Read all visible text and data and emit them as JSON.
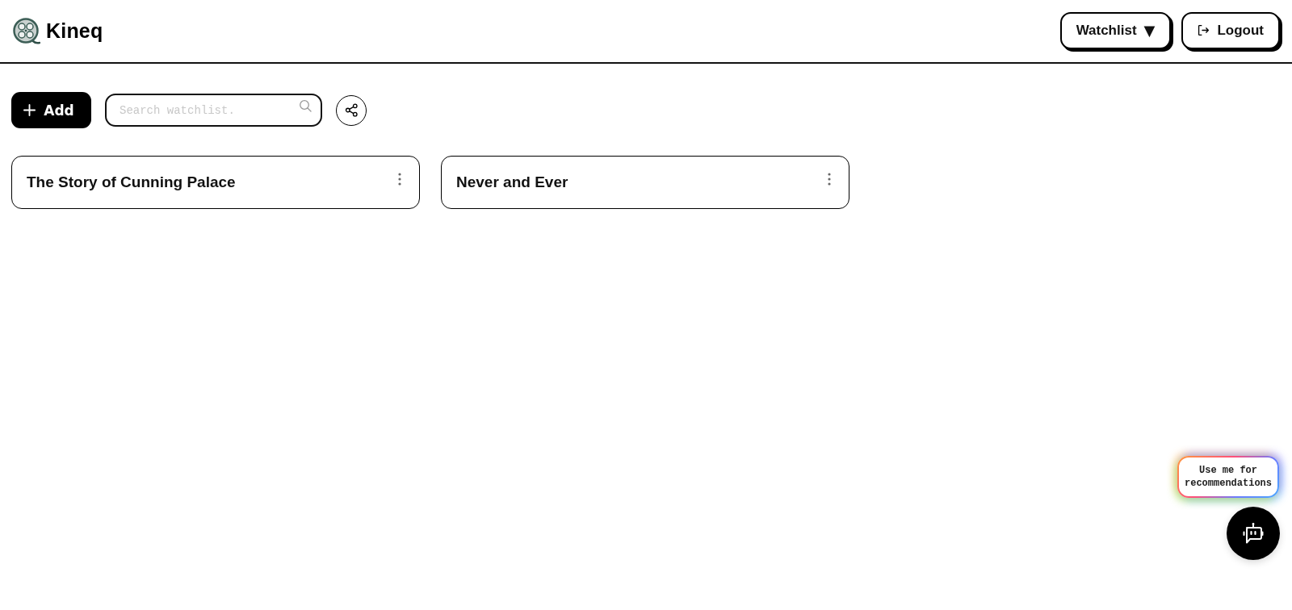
{
  "header": {
    "brand": "Kineq",
    "buttons": [
      {
        "kind": "dropdown",
        "label": "Watchlist",
        "caret": "▼"
      },
      {
        "kind": "logout",
        "label": "Logout"
      }
    ]
  },
  "toolbar": {
    "add_label": "Add",
    "search": {
      "placeholder": "Search watchlist."
    }
  },
  "cards": [
    {
      "title": "The Story of Cunning Palace"
    },
    {
      "title": "Never and Ever"
    }
  ],
  "assistant": {
    "tooltip": "Use me for recommendations"
  }
}
